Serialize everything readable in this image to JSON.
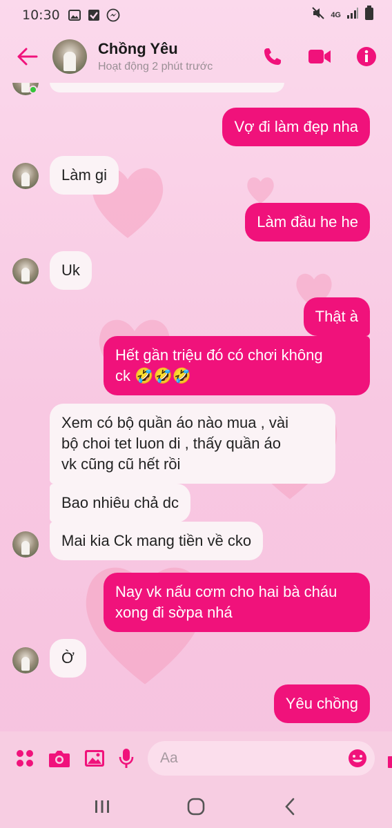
{
  "status_bar": {
    "time": "10:30",
    "network": "4G",
    "icons": [
      "gallery-icon",
      "check-square-icon",
      "messenger-icon",
      "mute-icon",
      "signal-icon",
      "battery-icon"
    ]
  },
  "header": {
    "contact_name": "Chồng Yêu",
    "contact_status": "Hoạt động 2 phút trước",
    "accent_color": "#f0127b"
  },
  "messages": [
    {
      "side": "out",
      "text": "Vợ đi làm đẹp nha"
    },
    {
      "side": "in",
      "text": "Làm gi"
    },
    {
      "side": "out",
      "text": "Làm đầu he he"
    },
    {
      "side": "in",
      "text": "Uk"
    },
    {
      "side": "out",
      "text": "Thật à"
    },
    {
      "side": "out",
      "lines": [
        "Hết gần triệu đó có chơi không",
        "ck 🤣🤣🤣"
      ]
    },
    {
      "side": "in",
      "lines": [
        "Xem có bộ quần áo nào mua ,  vài",
        "bộ choi tet luon di , thấy quần áo",
        "vk cũng cũ hết rồi"
      ]
    },
    {
      "side": "in",
      "text": "Bao nhiêu chả dc"
    },
    {
      "side": "in",
      "text": "Mai kia Ck mang tiền về cko"
    },
    {
      "side": "out",
      "lines": [
        "Nay vk nấu cơm cho hai bà cháu",
        "xong đi sờpa nhá"
      ]
    },
    {
      "side": "in",
      "text": "Ờ"
    },
    {
      "side": "out",
      "text": "Yêu chồng"
    }
  ],
  "composer": {
    "placeholder": "Aa"
  }
}
